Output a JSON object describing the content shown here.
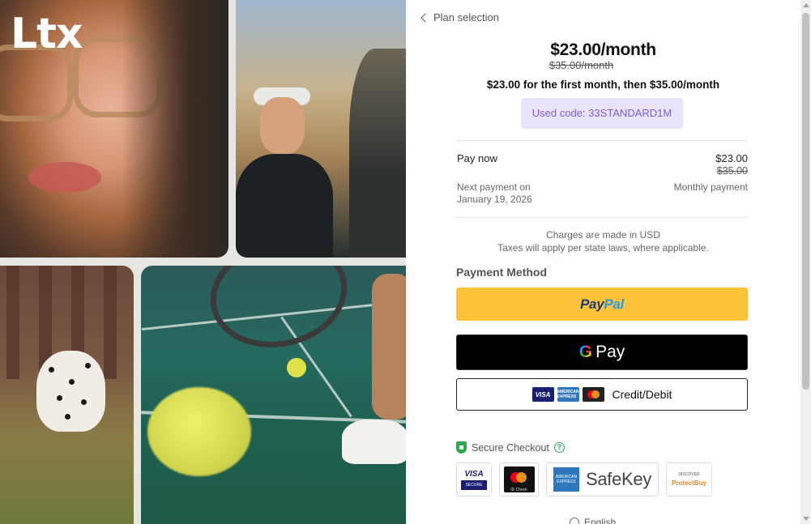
{
  "brand": {
    "logo_text": "Ltx"
  },
  "header": {
    "back_label": "Plan selection"
  },
  "pricing": {
    "price": "$23.00/month",
    "original_price": "$35.00/month",
    "promo_description": "$23.00 for the first month, then $35.00/month",
    "code_badge": "Used code: 33STANDARD1M"
  },
  "summary": {
    "pay_now_label": "Pay now",
    "pay_now_amount": "$23.00",
    "pay_now_original": "$35.00",
    "next_payment_label": "Next payment on",
    "next_payment_date": "January 19, 2026",
    "next_payment_type": "Monthly payment"
  },
  "notes": {
    "currency_note": "Charges are made in USD",
    "tax_note": "Taxes will apply per state laws, where applicable."
  },
  "payment": {
    "title": "Payment Method",
    "paypal_pay": "Pay",
    "paypal_pal": "Pal",
    "gpay_g": "G",
    "gpay_label": "Pay",
    "card_visa": "VISA",
    "card_amex": "AMERICAN EXPRESS",
    "card_label": "Credit/Debit",
    "paypal_color": "#fdc43a",
    "gpay_color": "#000000"
  },
  "security": {
    "label": "Secure Checkout",
    "help_glyph": "?",
    "badges": {
      "visa_top": "VISA",
      "visa_bottom": "SECURE",
      "mc_text": "ID Check",
      "amex_text": "AMERICAN EXPRESS",
      "safekey": "SafeKey",
      "protect_top": "DISCOVER",
      "protect_bottom": "ProtectBuy"
    }
  },
  "footer": {
    "language": "English"
  },
  "colors": {
    "accent_purple": "#7d5fcf",
    "badge_bg": "#e9e4fb",
    "secure_green": "#2fa84f"
  }
}
